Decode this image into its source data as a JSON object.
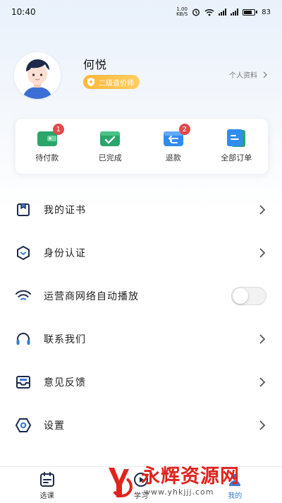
{
  "status_bar": {
    "time": "10:40",
    "net_speed_value": "1.00",
    "net_speed_unit": "KB/S",
    "battery": "83"
  },
  "profile": {
    "name": "何悦",
    "level_badge": "二级造价师",
    "profile_link": "个人资料"
  },
  "orders": [
    {
      "label": "待付款",
      "badge": "1",
      "icon": "wallet-pending-icon",
      "color": "#2aa66a"
    },
    {
      "label": "已完成",
      "badge": "",
      "icon": "wallet-done-icon",
      "color": "#2aa66a"
    },
    {
      "label": "退款",
      "badge": "2",
      "icon": "refund-icon",
      "color": "#2f8cf0"
    },
    {
      "label": "全部订单",
      "badge": "",
      "icon": "orders-icon",
      "color": "#2f8cf0"
    }
  ],
  "menu": [
    {
      "label": "我的证书",
      "icon": "certificate-icon"
    },
    {
      "label": "身份认证",
      "icon": "identity-icon"
    },
    {
      "label": "运营商网络自动播放",
      "icon": "wifi-icon",
      "toggle": false
    },
    {
      "label": "联系我们",
      "icon": "headphones-icon"
    },
    {
      "label": "意见反馈",
      "icon": "feedback-icon"
    },
    {
      "label": "设置",
      "icon": "settings-icon"
    }
  ],
  "tabbar": [
    {
      "label": "选课",
      "icon": "calendar-icon",
      "active": false
    },
    {
      "label": "学习",
      "icon": "study-icon",
      "active": false
    },
    {
      "label": "我的",
      "icon": "profile-icon",
      "active": true
    }
  ],
  "watermark": {
    "title": "永辉资源网",
    "url": "www.yhkjjj.com"
  },
  "colors": {
    "accent": "#3a7bd5",
    "badge_red": "#e04a4a",
    "gold": "#ffb63a"
  }
}
